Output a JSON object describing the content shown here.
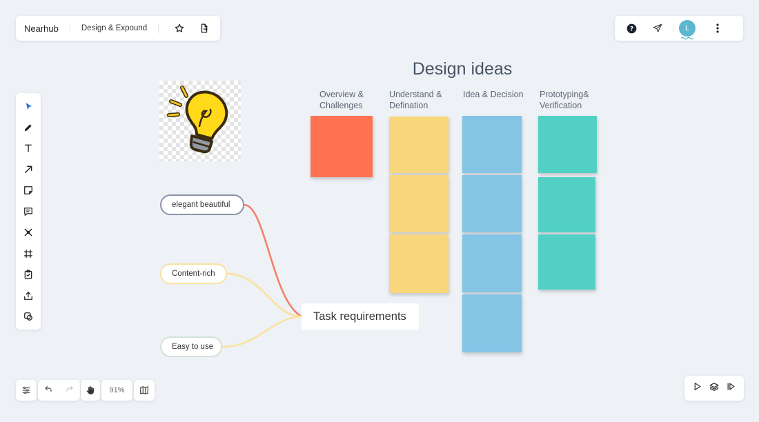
{
  "header": {
    "brand": "Nearhub",
    "board_name": "Design & Expound",
    "icons": [
      "star-icon",
      "export-doc-icon"
    ]
  },
  "top_right": {
    "icons": [
      "help-icon",
      "share-send-icon",
      "avatar",
      "more-vertical-icon"
    ],
    "avatar_initial": "L",
    "avatar_color": "#5bb8cf"
  },
  "toolbar": {
    "tools": [
      "select-pointer-icon",
      "pen-icon",
      "text-icon",
      "arrow-icon",
      "sticky-note-icon",
      "comment-icon",
      "mindmap-icon",
      "frame-icon",
      "checklist-icon",
      "upload-icon",
      "shapes-icon"
    ]
  },
  "bottom_left": {
    "zoom": "91%",
    "icons": [
      "settings-sliders-icon",
      "undo-icon",
      "redo-icon",
      "hand-pan-icon",
      "map-icon"
    ]
  },
  "bottom_right": {
    "icons": [
      "play-icon",
      "layers-icon",
      "present-icon"
    ]
  },
  "canvas": {
    "title": "Design ideas",
    "columns": [
      {
        "label": "Overview &\nChallenges",
        "color": "#ff7352",
        "notes": 1
      },
      {
        "label": "Understand &\nDefination",
        "color": "#f8d67b",
        "notes": 3
      },
      {
        "label": "Idea & Decision",
        "color": "#84c4e4",
        "notes": 4
      },
      {
        "label": "Prototyping&\nVerification",
        "color": "#53d0c6",
        "notes": 3
      }
    ],
    "mindmap": {
      "root": "Task requirements",
      "branches": [
        {
          "label": "elegant beautiful",
          "color": "#f27e65"
        },
        {
          "label": "Content-rich",
          "color": "#fae29c"
        },
        {
          "label": "Easy to use",
          "color": "#fae29c"
        }
      ]
    },
    "image": "lightbulb-image"
  }
}
